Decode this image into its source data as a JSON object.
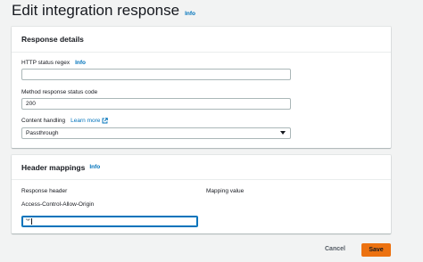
{
  "page": {
    "title": "Edit integration response",
    "info_label": "Info"
  },
  "response_details": {
    "title": "Response details",
    "http_status_regex": {
      "label": "HTTP status regex",
      "info_label": "Info",
      "value": ""
    },
    "method_response_status_code": {
      "label": "Method response status code",
      "value": "200"
    },
    "content_handling": {
      "label": "Content handling",
      "learn_more_label": "Learn more",
      "selected": "Passthrough"
    }
  },
  "header_mappings": {
    "title": "Header mappings",
    "info_label": "Info",
    "columns": [
      "Response header",
      "Mapping value"
    ],
    "rows": [
      {
        "response_header": "Access-Control-Allow-Origin",
        "mapping_value": "'*'"
      }
    ]
  },
  "footer": {
    "cancel_label": "Cancel",
    "save_label": "Save"
  },
  "colors": {
    "accent_link": "#0073bb",
    "primary_button": "#ec7211",
    "background": "#f2f3f3"
  }
}
